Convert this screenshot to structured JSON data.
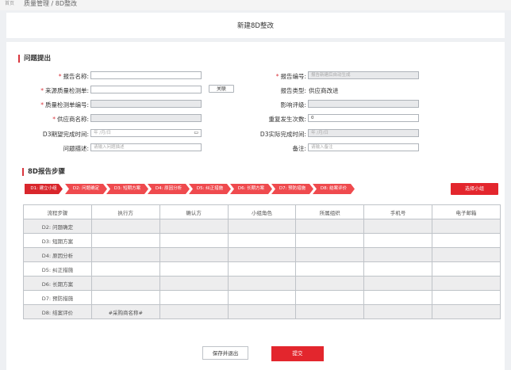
{
  "breadcrumb": {
    "home": "首页",
    "path": "质量管理 / 8D整改"
  },
  "page_title": "新建8D整改",
  "section1": {
    "title": "问题提出"
  },
  "form": {
    "report_name": {
      "label": "报告名称:",
      "value": ""
    },
    "report_no": {
      "label": "报告编号:",
      "placeholder": "报告新建后自动生成"
    },
    "source_form": {
      "label": "来源质量检测单:",
      "value": "",
      "associate_btn": "关联"
    },
    "report_type": {
      "label": "报告类型:",
      "value": "供应商改进"
    },
    "qc_form_no": {
      "label": "质量检测单编号:",
      "value": ""
    },
    "impact_level": {
      "label": "影响评级:",
      "value": ""
    },
    "supplier_name": {
      "label": "供应商名称:",
      "value": ""
    },
    "repeat_count": {
      "label": "重复发生次数:",
      "value": "0"
    },
    "d3_expected": {
      "label": "D3期望完成时间:",
      "placeholder": "年 /月/日"
    },
    "d3_actual": {
      "label": "D3实际完成时间:",
      "placeholder": "年 /月/日"
    },
    "problem_desc": {
      "label": "问题描述:",
      "placeholder": "请输入问题描述"
    },
    "remark": {
      "label": "备注:",
      "placeholder": "请输入备注"
    }
  },
  "section2": {
    "title": "8D报告步骤"
  },
  "steps": [
    {
      "label": "D1: 建立小组"
    },
    {
      "label": "D2: 问题确定"
    },
    {
      "label": "D3: 短期方案"
    },
    {
      "label": "D4: 原因分析"
    },
    {
      "label": "D5: 纠正措施"
    },
    {
      "label": "D6: 长期方案"
    },
    {
      "label": "D7: 预防措施"
    },
    {
      "label": "D8: 结案评价"
    }
  ],
  "select_group_btn": "选择小组",
  "table": {
    "headers": [
      "流程步骤",
      "执行方",
      "确认方",
      "小组角色",
      "所属组织",
      "手机号",
      "电子邮箱"
    ],
    "rows": [
      [
        "D2: 问题确定",
        "",
        "",
        "",
        "",
        "",
        ""
      ],
      [
        "D3: 短期方案",
        "",
        "",
        "",
        "",
        "",
        ""
      ],
      [
        "D4: 原因分析",
        "",
        "",
        "",
        "",
        "",
        ""
      ],
      [
        "D5: 纠正措施",
        "",
        "",
        "",
        "",
        "",
        ""
      ],
      [
        "D6: 长期方案",
        "",
        "",
        "",
        "",
        "",
        ""
      ],
      [
        "D7: 预防措施",
        "",
        "",
        "",
        "",
        "",
        ""
      ],
      [
        "D8: 结案评价",
        "#采购商名称#",
        "",
        "",
        "",
        "",
        ""
      ]
    ]
  },
  "buttons": {
    "save_exit": "保存并退出",
    "submit": "提交"
  },
  "colors": {
    "accent": "#e3262d",
    "border": "#aeb3b9",
    "disabled_bg": "#e8e9eb"
  }
}
